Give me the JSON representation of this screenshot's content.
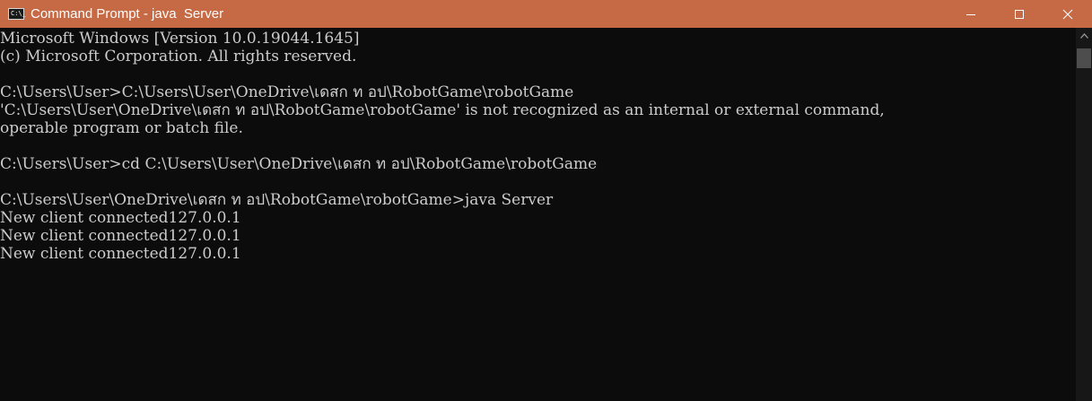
{
  "window": {
    "title": "Command Prompt - java  Server",
    "app_icon_glyph": "C:\\_",
    "icons": {
      "app": "command-prompt-icon",
      "minimize": "minimize-icon",
      "maximize": "maximize-icon",
      "close": "close-icon"
    },
    "colors": {
      "titlebar": "#c66a45",
      "console_background": "#0c0c0c",
      "console_text": "#cccccc"
    }
  },
  "console": {
    "lines": [
      "Microsoft Windows [Version 10.0.19044.1645]",
      "(c) Microsoft Corporation. All rights reserved.",
      "",
      "C:\\Users\\User>C:\\Users\\User\\OneDrive\\เดสก ท อป\\RobotGame\\robotGame",
      "'C:\\Users\\User\\OneDrive\\เดสก ท อป\\RobotGame\\robotGame' is not recognized as an internal or external command,",
      "operable program or batch file.",
      "",
      "C:\\Users\\User>cd C:\\Users\\User\\OneDrive\\เดสก ท อป\\RobotGame\\robotGame",
      "",
      "C:\\Users\\User\\OneDrive\\เดสก ท อป\\RobotGame\\robotGame>java Server",
      "New client connected127.0.0.1",
      "New client connected127.0.0.1",
      "New client connected127.0.0.1"
    ]
  }
}
